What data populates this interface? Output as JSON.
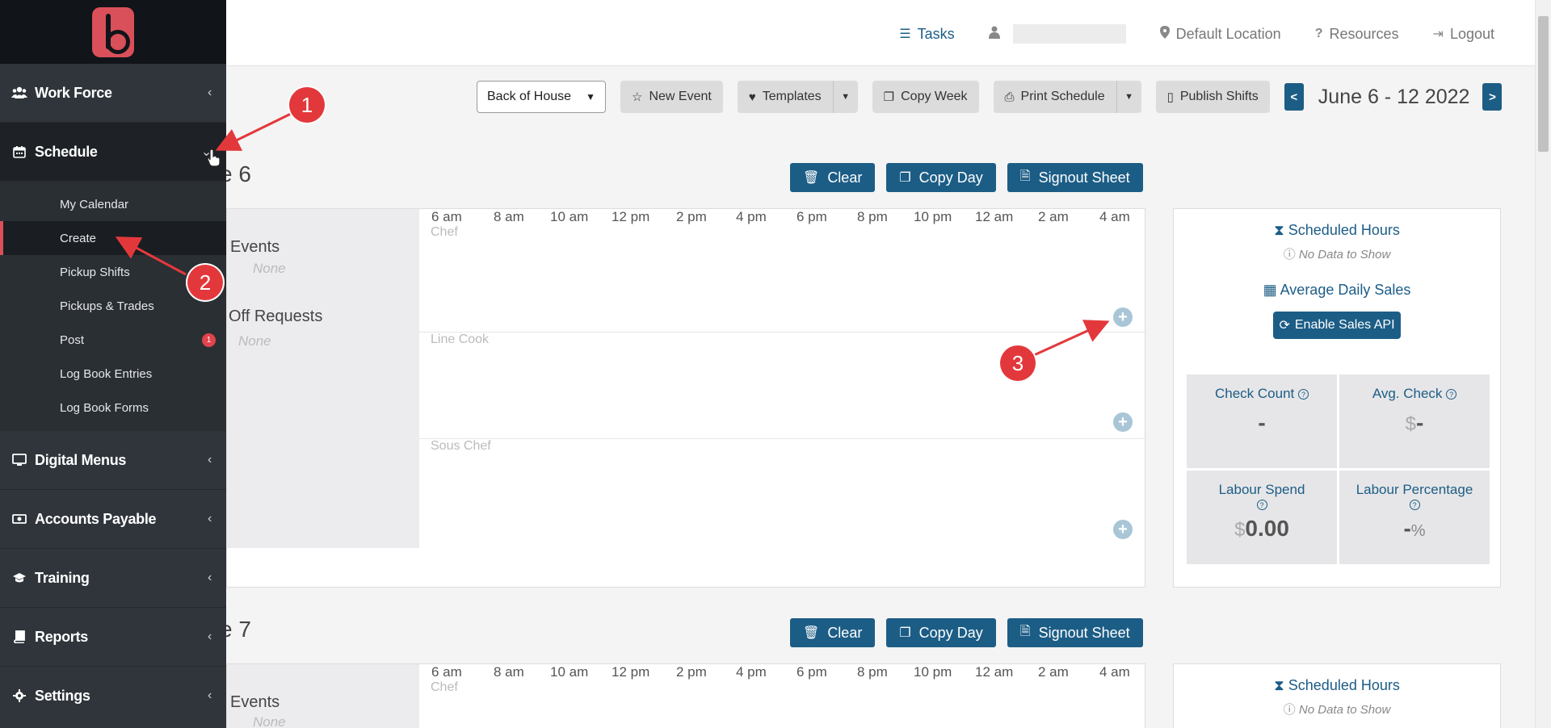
{
  "sidebar": {
    "items": [
      {
        "label": "Work Force",
        "icon": "users-icon"
      },
      {
        "label": "Schedule",
        "icon": "calendar-icon"
      },
      {
        "label": "Digital Menus",
        "icon": "monitor-icon"
      },
      {
        "label": "Accounts Payable",
        "icon": "money-icon"
      },
      {
        "label": "Training",
        "icon": "graduation-cap-icon"
      },
      {
        "label": "Reports",
        "icon": "book-icon"
      },
      {
        "label": "Settings",
        "icon": "gear-icon"
      }
    ],
    "schedule_sub": [
      {
        "label": "My Calendar"
      },
      {
        "label": "Create"
      },
      {
        "label": "Pickup Shifts"
      },
      {
        "label": "Pickups & Trades"
      },
      {
        "label": "Post",
        "badge": "1"
      },
      {
        "label": "Log Book Entries"
      },
      {
        "label": "Log Book Forms"
      }
    ]
  },
  "topbar": {
    "tasks": "Tasks",
    "location": "Default Location",
    "resources": "Resources",
    "logout": "Logout"
  },
  "toolbar": {
    "location_select": "Back of House",
    "new_event": "New Event",
    "templates": "Templates",
    "copy_week": "Copy Week",
    "print_schedule": "Print Schedule",
    "publish_shifts": "Publish Shifts",
    "prev": "<",
    "next": ">",
    "week_label": "June 6 - 12 2022"
  },
  "days": [
    {
      "title": "e 6",
      "clear": "Clear",
      "copy_day": "Copy Day",
      "signout": "Signout Sheet",
      "events_label": "Events",
      "events_value": "None",
      "off_label": "Off Requests",
      "off_value": "None",
      "hours": [
        "6 am",
        "8 am",
        "10 am",
        "12 pm",
        "2 pm",
        "4 pm",
        "6 pm",
        "8 pm",
        "10 pm",
        "12 am",
        "2 am",
        "4 am"
      ],
      "roles": [
        "Chef",
        "Line Cook",
        "Sous Chef"
      ]
    },
    {
      "title": "e 7",
      "clear": "Clear",
      "copy_day": "Copy Day",
      "signout": "Signout Sheet",
      "events_label": "Events",
      "events_value": "None",
      "hours": [
        "6 am",
        "8 am",
        "10 am",
        "12 pm",
        "2 pm",
        "4 pm",
        "6 pm",
        "8 pm",
        "10 pm",
        "12 am",
        "2 am",
        "4 am"
      ],
      "roles": [
        "Chef"
      ]
    }
  ],
  "stats": {
    "scheduled_hours": "Scheduled Hours",
    "no_data": "No Data to Show",
    "avg_daily_sales": "Average Daily Sales",
    "enable_sales_api": "Enable Sales API",
    "check_count": "Check Count",
    "check_count_value": "-",
    "avg_check": "Avg. Check",
    "avg_check_prefix": "$",
    "avg_check_value": "-",
    "labour_spend": "Labour Spend",
    "labour_spend_prefix": "$",
    "labour_spend_value": "0.00",
    "labour_pct": "Labour Percentage",
    "labour_pct_value": "-",
    "labour_pct_suffix": "%"
  },
  "annotations": [
    "1",
    "2",
    "3"
  ],
  "colors": {
    "accent": "#1c5d86",
    "brand": "#d9505a",
    "marker": "#e3383b"
  }
}
